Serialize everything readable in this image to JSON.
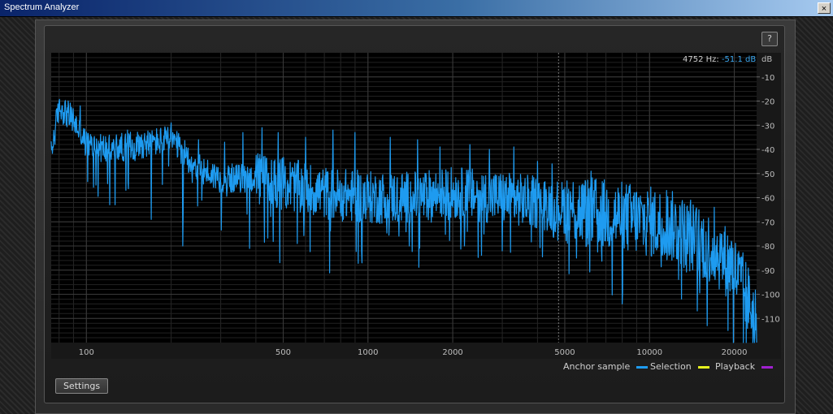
{
  "window": {
    "title": "Spectrum Analyzer",
    "close_glyph": "×"
  },
  "toolbar": {
    "help_label": "?",
    "settings_label": "Settings"
  },
  "readout": {
    "frequency": "4752 Hz:",
    "level": "-51.1 dB"
  },
  "legend": {
    "items": [
      {
        "label": "Anchor sample",
        "color": "#1e9bf0"
      },
      {
        "label": "Selection",
        "color": "#e6f21e"
      },
      {
        "label": "Playback",
        "color": "#a020d0"
      }
    ]
  },
  "chart_data": {
    "type": "line",
    "x_scale": "log",
    "xlim": [
      75,
      24000
    ],
    "ylim": [
      -120,
      0
    ],
    "ylabel": "dB",
    "x_ticks": [
      100,
      500,
      1000,
      2000,
      5000,
      10000,
      20000
    ],
    "x_tick_labels": [
      "100",
      "500",
      "1000",
      "2000",
      "5000",
      "10000",
      "20000"
    ],
    "y_ticks": [
      -10,
      -20,
      -30,
      -40,
      -50,
      -60,
      -70,
      -80,
      -90,
      -100,
      -110
    ],
    "y_tick_labels": [
      "-10",
      "-20",
      "-30",
      "-40",
      "-50",
      "-60",
      "-70",
      "-80",
      "-90",
      "-100",
      "-110"
    ],
    "cursor_frequency": 4752,
    "series": [
      {
        "name": "Anchor sample",
        "color": "#1e9bf0",
        "envelope": {
          "x": [
            75,
            80,
            90,
            100,
            120,
            150,
            200,
            250,
            300,
            400,
            500,
            700,
            1000,
            1500,
            2000,
            3000,
            4000,
            5000,
            6000,
            8000,
            10000,
            12000,
            15000,
            18000,
            20000,
            22000,
            24000
          ],
          "y": [
            -42,
            -22,
            -28,
            -38,
            -40,
            -38,
            -36,
            -48,
            -52,
            -52,
            -54,
            -58,
            -60,
            -60,
            -58,
            -60,
            -62,
            -64,
            -66,
            -68,
            -70,
            -72,
            -78,
            -84,
            -90,
            -100,
            -112
          ]
        },
        "peaks": [
          {
            "x": 80,
            "y": -20
          },
          {
            "x": 95,
            "y": -22
          },
          {
            "x": 140,
            "y": -32
          },
          {
            "x": 200,
            "y": -29
          },
          {
            "x": 250,
            "y": -36
          },
          {
            "x": 310,
            "y": -37
          },
          {
            "x": 360,
            "y": -33
          },
          {
            "x": 420,
            "y": -31
          },
          {
            "x": 480,
            "y": -33
          },
          {
            "x": 600,
            "y": -35
          },
          {
            "x": 750,
            "y": -32
          },
          {
            "x": 900,
            "y": -33
          },
          {
            "x": 1200,
            "y": -35
          },
          {
            "x": 1500,
            "y": -36
          },
          {
            "x": 1800,
            "y": -39
          },
          {
            "x": 2300,
            "y": -38
          },
          {
            "x": 2700,
            "y": -40
          },
          {
            "x": 3300,
            "y": -39
          },
          {
            "x": 4000,
            "y": -45
          },
          {
            "x": 4500,
            "y": -46
          },
          {
            "x": 6200,
            "y": -49
          },
          {
            "x": 8500,
            "y": -58
          },
          {
            "x": 11500,
            "y": -57
          },
          {
            "x": 14000,
            "y": -61
          },
          {
            "x": 17000,
            "y": -64
          },
          {
            "x": 19500,
            "y": -78
          }
        ],
        "dips": [
          {
            "x": 170,
            "y": -69
          },
          {
            "x": 220,
            "y": -80
          },
          {
            "x": 380,
            "y": -81
          },
          {
            "x": 560,
            "y": -79
          },
          {
            "x": 950,
            "y": -82
          },
          {
            "x": 1400,
            "y": -80
          },
          {
            "x": 2200,
            "y": -80
          },
          {
            "x": 3000,
            "y": -82
          },
          {
            "x": 5500,
            "y": -85
          },
          {
            "x": 8000,
            "y": -104
          },
          {
            "x": 13000,
            "y": -102
          },
          {
            "x": 16000,
            "y": -113
          },
          {
            "x": 19000,
            "y": -115
          },
          {
            "x": 21500,
            "y": -120
          }
        ]
      }
    ]
  }
}
